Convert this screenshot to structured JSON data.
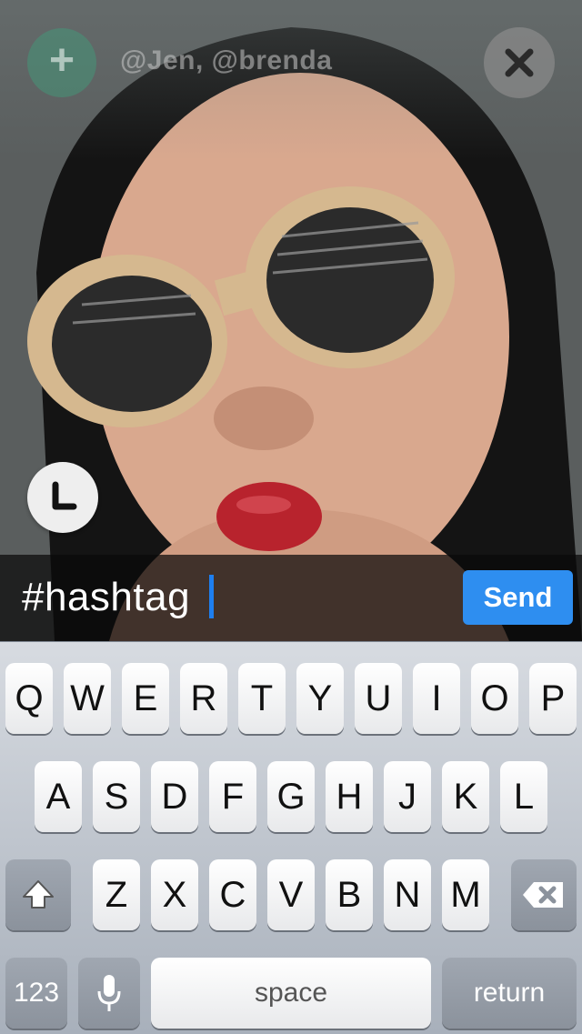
{
  "header": {
    "recipients": "@Jen, @brenda"
  },
  "caption": {
    "text": "#hashtag",
    "send_label": "Send"
  },
  "keyboard": {
    "row1": [
      "Q",
      "W",
      "E",
      "R",
      "T",
      "Y",
      "U",
      "I",
      "O",
      "P"
    ],
    "row2": [
      "A",
      "S",
      "D",
      "F",
      "G",
      "H",
      "J",
      "K",
      "L"
    ],
    "row3": [
      "Z",
      "X",
      "C",
      "V",
      "B",
      "N",
      "M"
    ],
    "numbers_label": "123",
    "space_label": "space",
    "return_label": "return"
  },
  "icons": {
    "add": "plus-icon",
    "close": "close-icon",
    "timer": "clock-icon",
    "shift": "shift-icon",
    "delete": "delete-icon",
    "mic": "microphone-icon"
  },
  "colors": {
    "accent": "#2e8ef0",
    "cursor": "#1e7ff0"
  }
}
